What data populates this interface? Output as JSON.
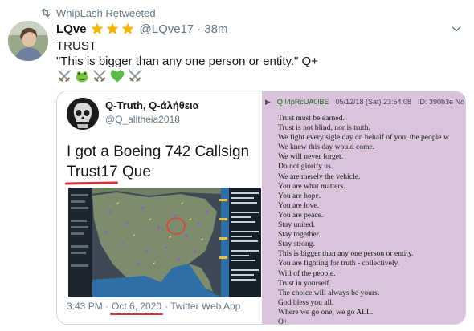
{
  "retweet": {
    "label": "WhipLash Retweeted",
    "icon": "retweet-icon"
  },
  "tweet": {
    "name": "LQve",
    "star_count": 3,
    "handle": "@LQve17",
    "time": "38m",
    "line1": "TRUST",
    "line2": "\"This is bigger than any one person or entity.\" Q+",
    "emojis": [
      "crossed-swords-icon",
      "frog-icon",
      "crossed-swords-icon",
      "green-heart-icon",
      "crossed-swords-icon"
    ]
  },
  "quoted": {
    "name": "Q-Truth, Q-άλήθεια",
    "handle": "@Q_alitheia2018",
    "body_line1": "I got a Boeing 742 Callsign",
    "body_underlined": "Trust17",
    "body_rest": " Que",
    "footer_time": "3:43 PM ·",
    "footer_date": "Oct 6, 2020",
    "footer_source": "· Twitter Web App"
  },
  "post": {
    "arrow": "▶",
    "trip": "Q !4pRcUA0lBE",
    "datetime": "05/12/18 (Sat) 23:54:08",
    "id": "ID: 390b3e No",
    "lines": [
      "Trust must be earned.",
      "Trust is not blind, nor is truth.",
      "We fight every sigle day on behalf of you, the people w",
      "We knew this day would come.",
      "We will never forget.",
      "Do not glorify us.",
      "We are merely the vehicle.",
      "You are what matters.",
      "You are hope.",
      "You are love.",
      "You are peace.",
      "Stay united.",
      "Stay together.",
      "Stay strong.",
      "This is bigger than any one person or entity.",
      "You are fighting for truth - collectively.",
      "Will of the people.",
      "Trust in yourself.",
      "The choice will always be yours.",
      "God bless you all.",
      "Where we go one, we go ALL.",
      "Q+"
    ]
  },
  "colors": {
    "accent_red": "#d9303a",
    "post_bg": "#d9c4dc",
    "trip_green": "#1b5e20",
    "muted": "#657786"
  }
}
